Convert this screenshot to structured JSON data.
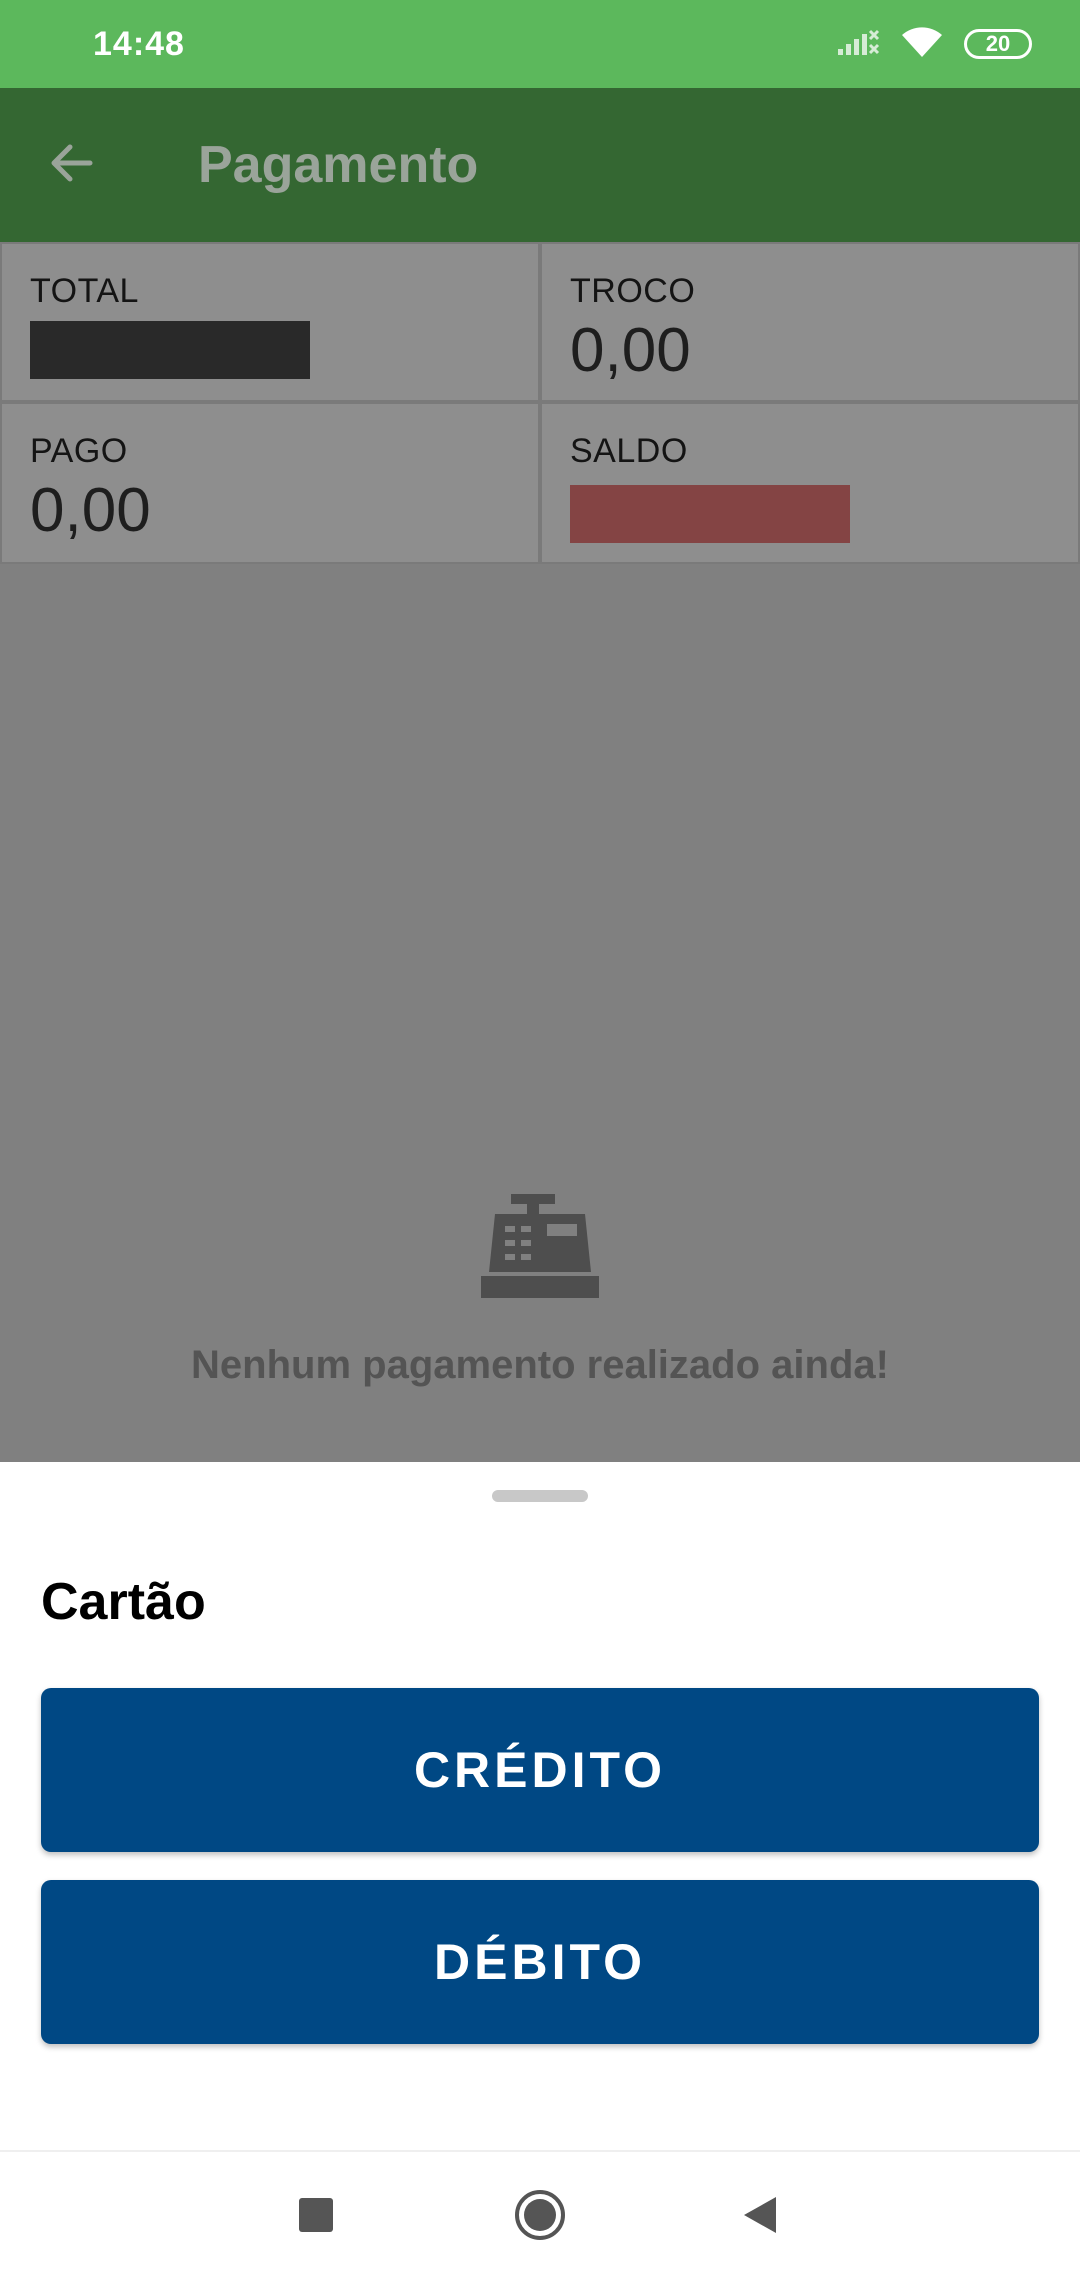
{
  "status_bar": {
    "time": "14:48",
    "battery": "20",
    "icons": [
      "signal-icon",
      "wifi-icon",
      "battery-icon"
    ]
  },
  "app_bar": {
    "title": "Pagamento",
    "back_icon": "arrow-left-icon"
  },
  "summary": {
    "total_label": "TOTAL",
    "troco_label": "TROCO",
    "troco_value": "0,00",
    "pago_label": "PAGO",
    "pago_value": "0,00",
    "saldo_label": "SALDO"
  },
  "empty_state": {
    "icon": "cash-register-icon",
    "message": "Nenhum pagamento realizado ainda!"
  },
  "sheet": {
    "title": "Cartão",
    "credit_label": "CRÉDITO",
    "debit_label": "DÉBITO"
  },
  "nav_bar": {
    "icons": [
      "recents-square-icon",
      "home-circle-icon",
      "back-triangle-icon"
    ]
  },
  "colors": {
    "status_bar": "#5cb85c",
    "app_bar": "#346732",
    "button": "#004884",
    "redacted_red": "#844444"
  }
}
